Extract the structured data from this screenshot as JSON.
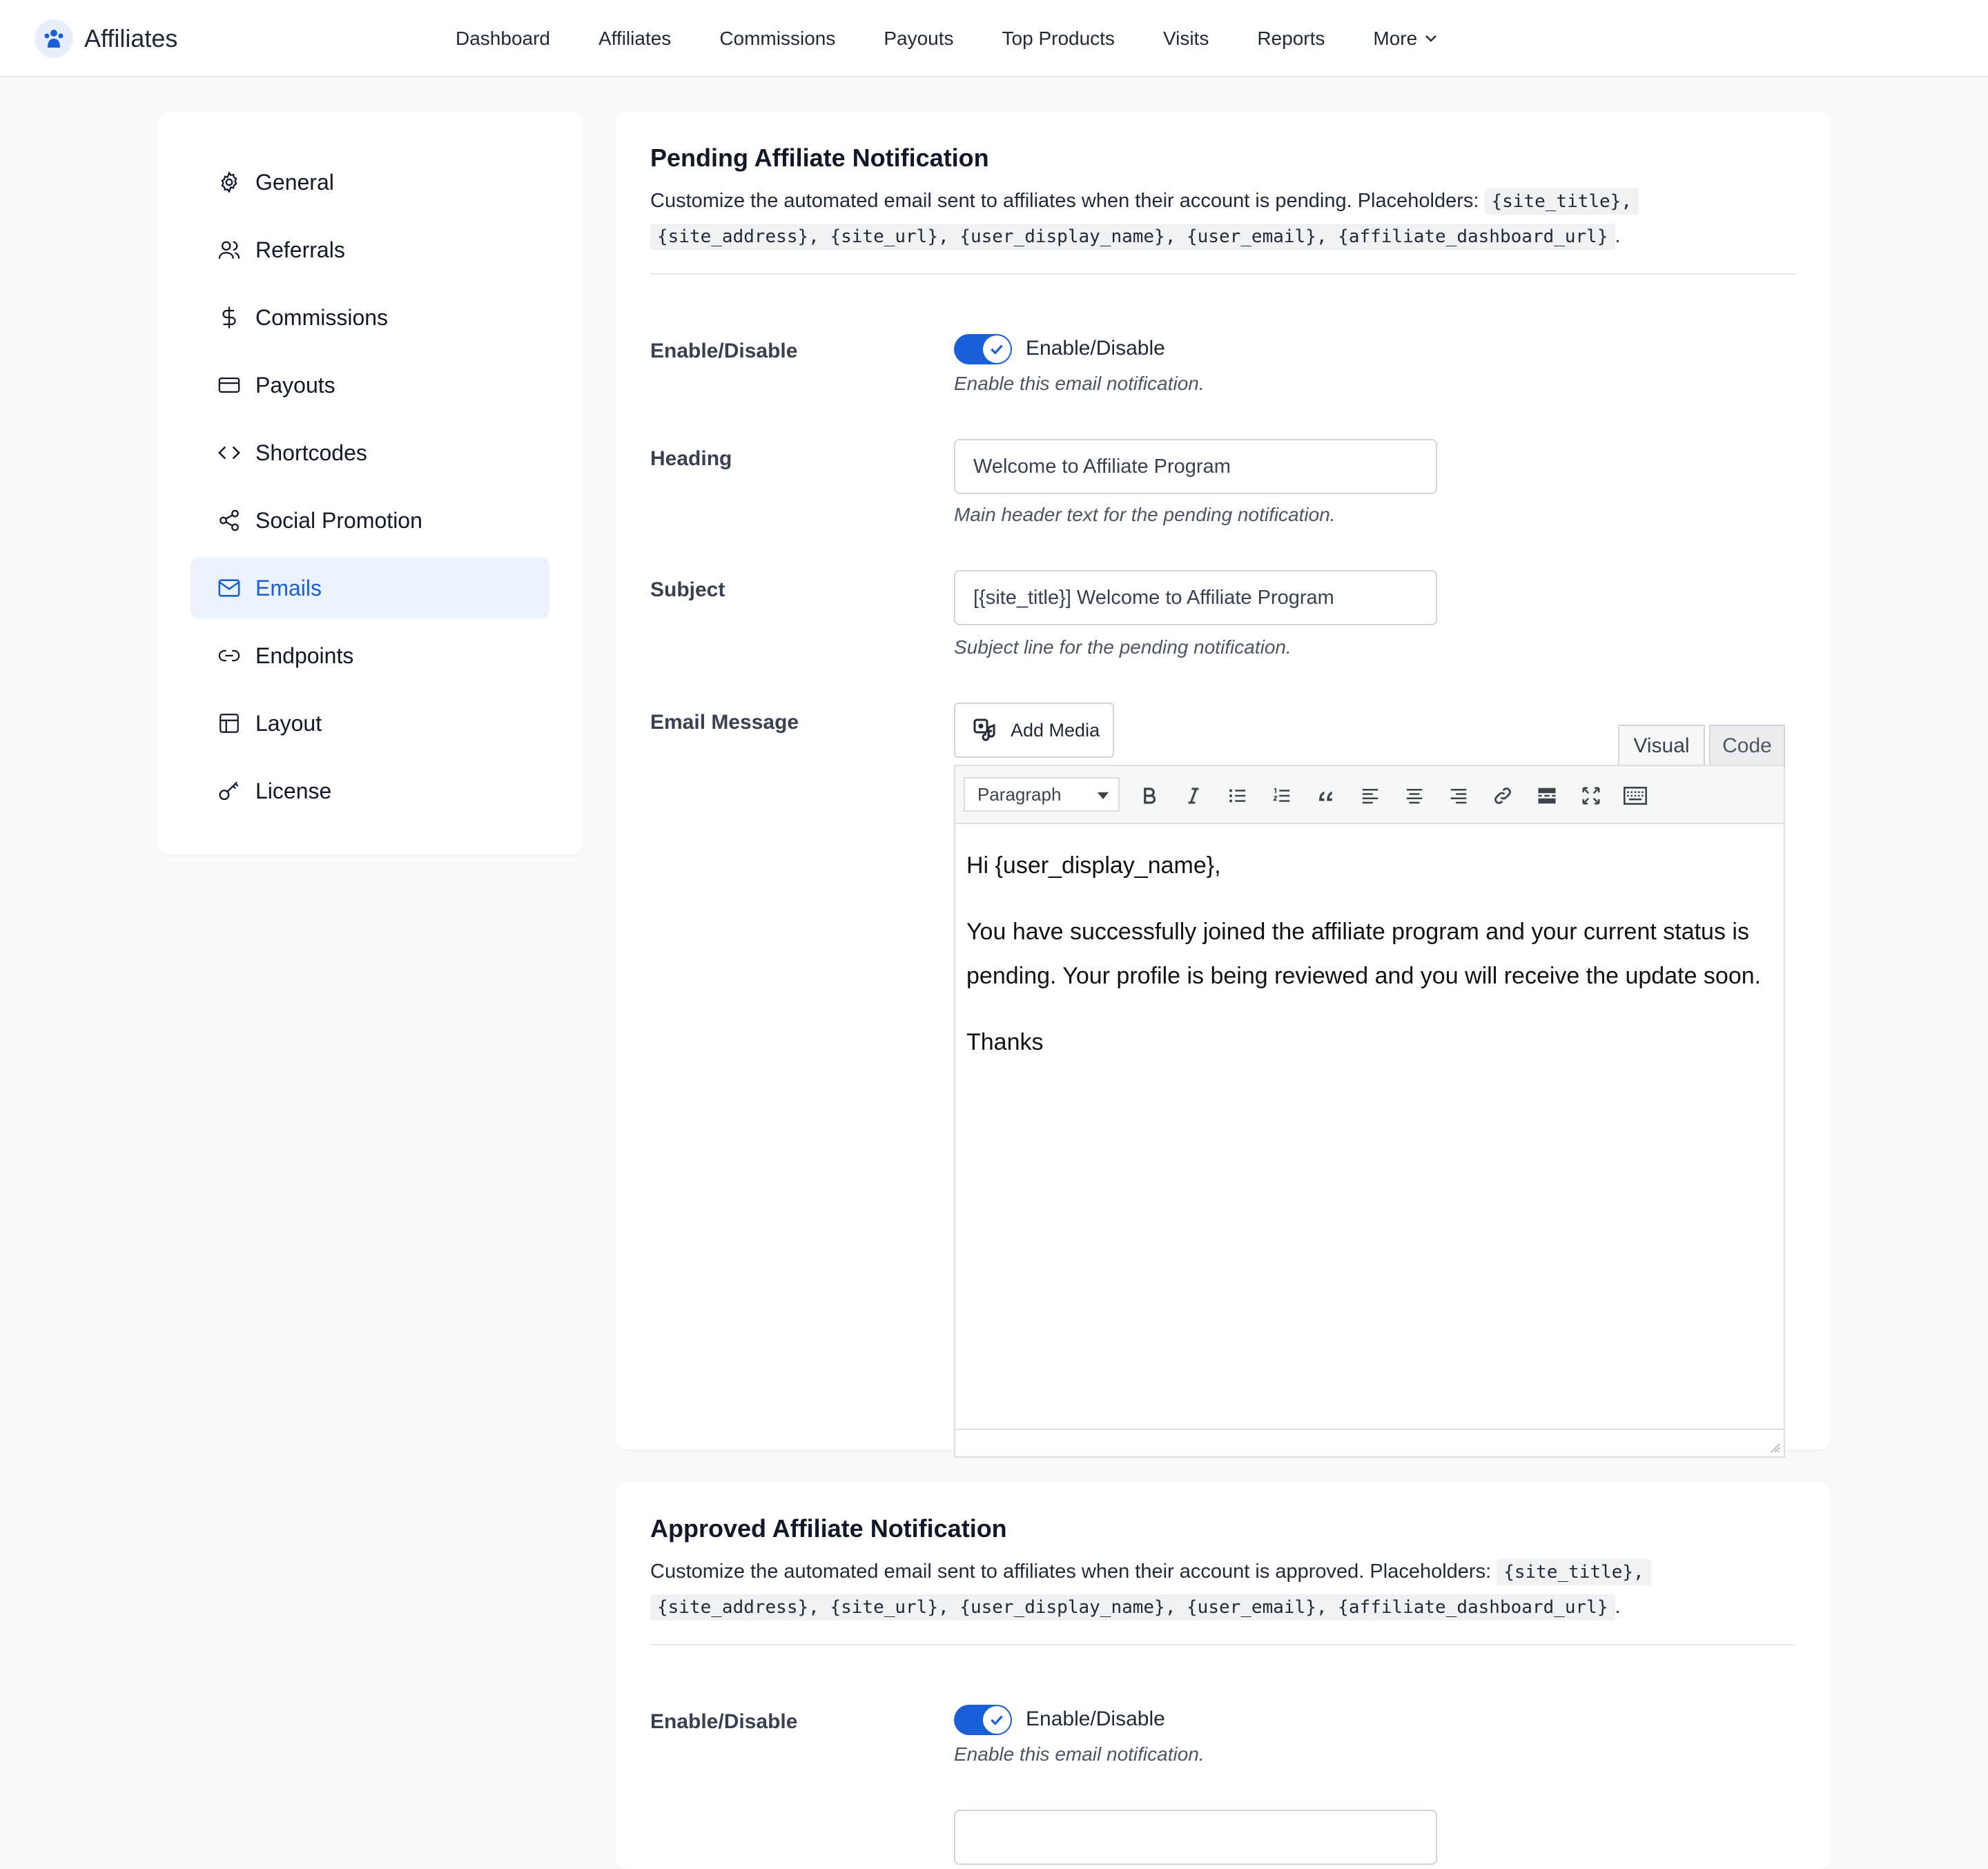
{
  "app": {
    "name": "Affiliates",
    "brand_color": "#1a5fd7"
  },
  "nav": {
    "items": [
      "Dashboard",
      "Affiliates",
      "Commissions",
      "Payouts",
      "Top Products",
      "Visits",
      "Reports",
      "More"
    ]
  },
  "sidebar": {
    "items": [
      {
        "label": "General",
        "icon": "gear-icon"
      },
      {
        "label": "Referrals",
        "icon": "users-icon"
      },
      {
        "label": "Commissions",
        "icon": "dollar-icon"
      },
      {
        "label": "Payouts",
        "icon": "credit-card-icon"
      },
      {
        "label": "Shortcodes",
        "icon": "code-icon"
      },
      {
        "label": "Social Promotion",
        "icon": "share-icon"
      },
      {
        "label": "Emails",
        "icon": "mail-icon",
        "active": true
      },
      {
        "label": "Endpoints",
        "icon": "link-icon"
      },
      {
        "label": "Layout",
        "icon": "layout-icon"
      },
      {
        "label": "License",
        "icon": "key-icon"
      }
    ]
  },
  "pending": {
    "title": "Pending Affiliate Notification",
    "desc_prefix": "Customize the automated email sent to affiliates when their account is pending. Placeholders:",
    "placeholders": [
      "{site_title},",
      "{site_address}, {site_url}, {user_display_name}, {user_email}, {affiliate_dashboard_url}"
    ],
    "desc_suffix": ".",
    "enable": {
      "label": "Enable/Disable",
      "toggle_text": "Enable/Disable",
      "help": "Enable this email notification.",
      "enabled": true
    },
    "heading": {
      "label": "Heading",
      "value": "Welcome to Affiliate Program",
      "help": "Main header text for the pending notification."
    },
    "subject": {
      "label": "Subject",
      "value": "[{site_title}] Welcome to Affiliate Program",
      "help": "Subject line for the pending notification."
    },
    "message": {
      "label": "Email Message",
      "add_media": "Add Media",
      "tab_visual": "Visual",
      "tab_code": "Code",
      "format": "Paragraph",
      "paragraphs": [
        "Hi {user_display_name},",
        "You have successfully joined the affiliate program and your current status is pending. Your profile is being reviewed and you will receive the update soon.",
        "Thanks"
      ]
    }
  },
  "approved": {
    "title": "Approved Affiliate Notification",
    "desc_prefix": "Customize the automated email sent to affiliates when their account is approved. Placeholders:",
    "placeholders": [
      "{site_title},",
      "{site_address}, {site_url}, {user_display_name}, {user_email}, {affiliate_dashboard_url}"
    ],
    "desc_suffix": ".",
    "enable": {
      "label": "Enable/Disable",
      "toggle_text": "Enable/Disable",
      "help": "Enable this email notification.",
      "enabled": true
    }
  }
}
